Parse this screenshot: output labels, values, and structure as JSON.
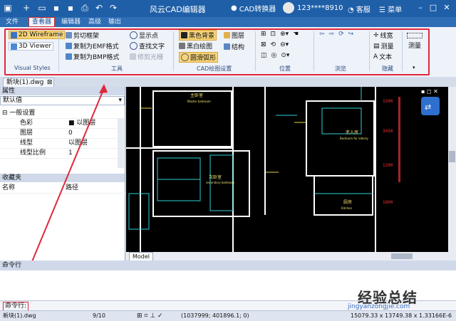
{
  "titlebar": {
    "app_title": "风云CAD编辑器",
    "converter": "CAD转换器",
    "user": "123****8910",
    "service": "客服",
    "menu": "菜单"
  },
  "menu_tabs": [
    "文件",
    "查看器",
    "编辑器",
    "高级",
    "输出"
  ],
  "ribbon": {
    "visual_styles": {
      "wireframe": "2D Wireframe",
      "viewer3d": "3D Viewer",
      "group": "Visual Styles"
    },
    "tools": {
      "items": [
        "剪切框架",
        "复制为EMF格式",
        "复制为BMP格式",
        "显示点",
        "查找文字",
        "修剪光栅"
      ],
      "group": "工具"
    },
    "cad_settings": {
      "items": [
        "黑色背景",
        "黑白绘图",
        "圆滑弧形",
        "图层",
        "结构"
      ],
      "group": "CAD绘图设置"
    },
    "position": {
      "group": "位置"
    },
    "browse": {
      "group": "浏览"
    },
    "hide": {
      "items": [
        "线宽",
        "测量",
        "文本"
      ],
      "group": "隐藏"
    },
    "measure": "测量"
  },
  "doc_tab": "新块(1).dwg",
  "properties": {
    "title": "属性",
    "default": "默认值",
    "section": "一般设置",
    "rows": [
      {
        "key": "色彩",
        "value": "以图层"
      },
      {
        "key": "图层",
        "value": "0"
      },
      {
        "key": "线型",
        "value": "以图层"
      },
      {
        "key": "线型比例",
        "value": "1"
      }
    ]
  },
  "favorites": {
    "title": "收藏夹",
    "col_name": "名称",
    "col_path": "路径"
  },
  "drawing": {
    "rooms": [
      "主卧室",
      "次卧室",
      "老人房",
      "厨房"
    ],
    "room_sub": [
      "Master bedroom",
      "secondary bedroom",
      "Bedroom for elderly",
      "Kitchen"
    ]
  },
  "model_tab": "Model",
  "command": {
    "header": "命令行",
    "input_label": "命令行:"
  },
  "status": {
    "file": "新块(1).dwg",
    "page": "9/10",
    "coords": "(1037999; 401896.1; 0)",
    "right": "15079.33 x 13749.38 x 1.33166E-6"
  },
  "watermark": {
    "main": "经验总结",
    "url": "jingyanzongjie.com"
  },
  "colors": {
    "accent": "#e0283a",
    "titlebar": "#1e5fa8",
    "drawing_bg": "#000000"
  }
}
